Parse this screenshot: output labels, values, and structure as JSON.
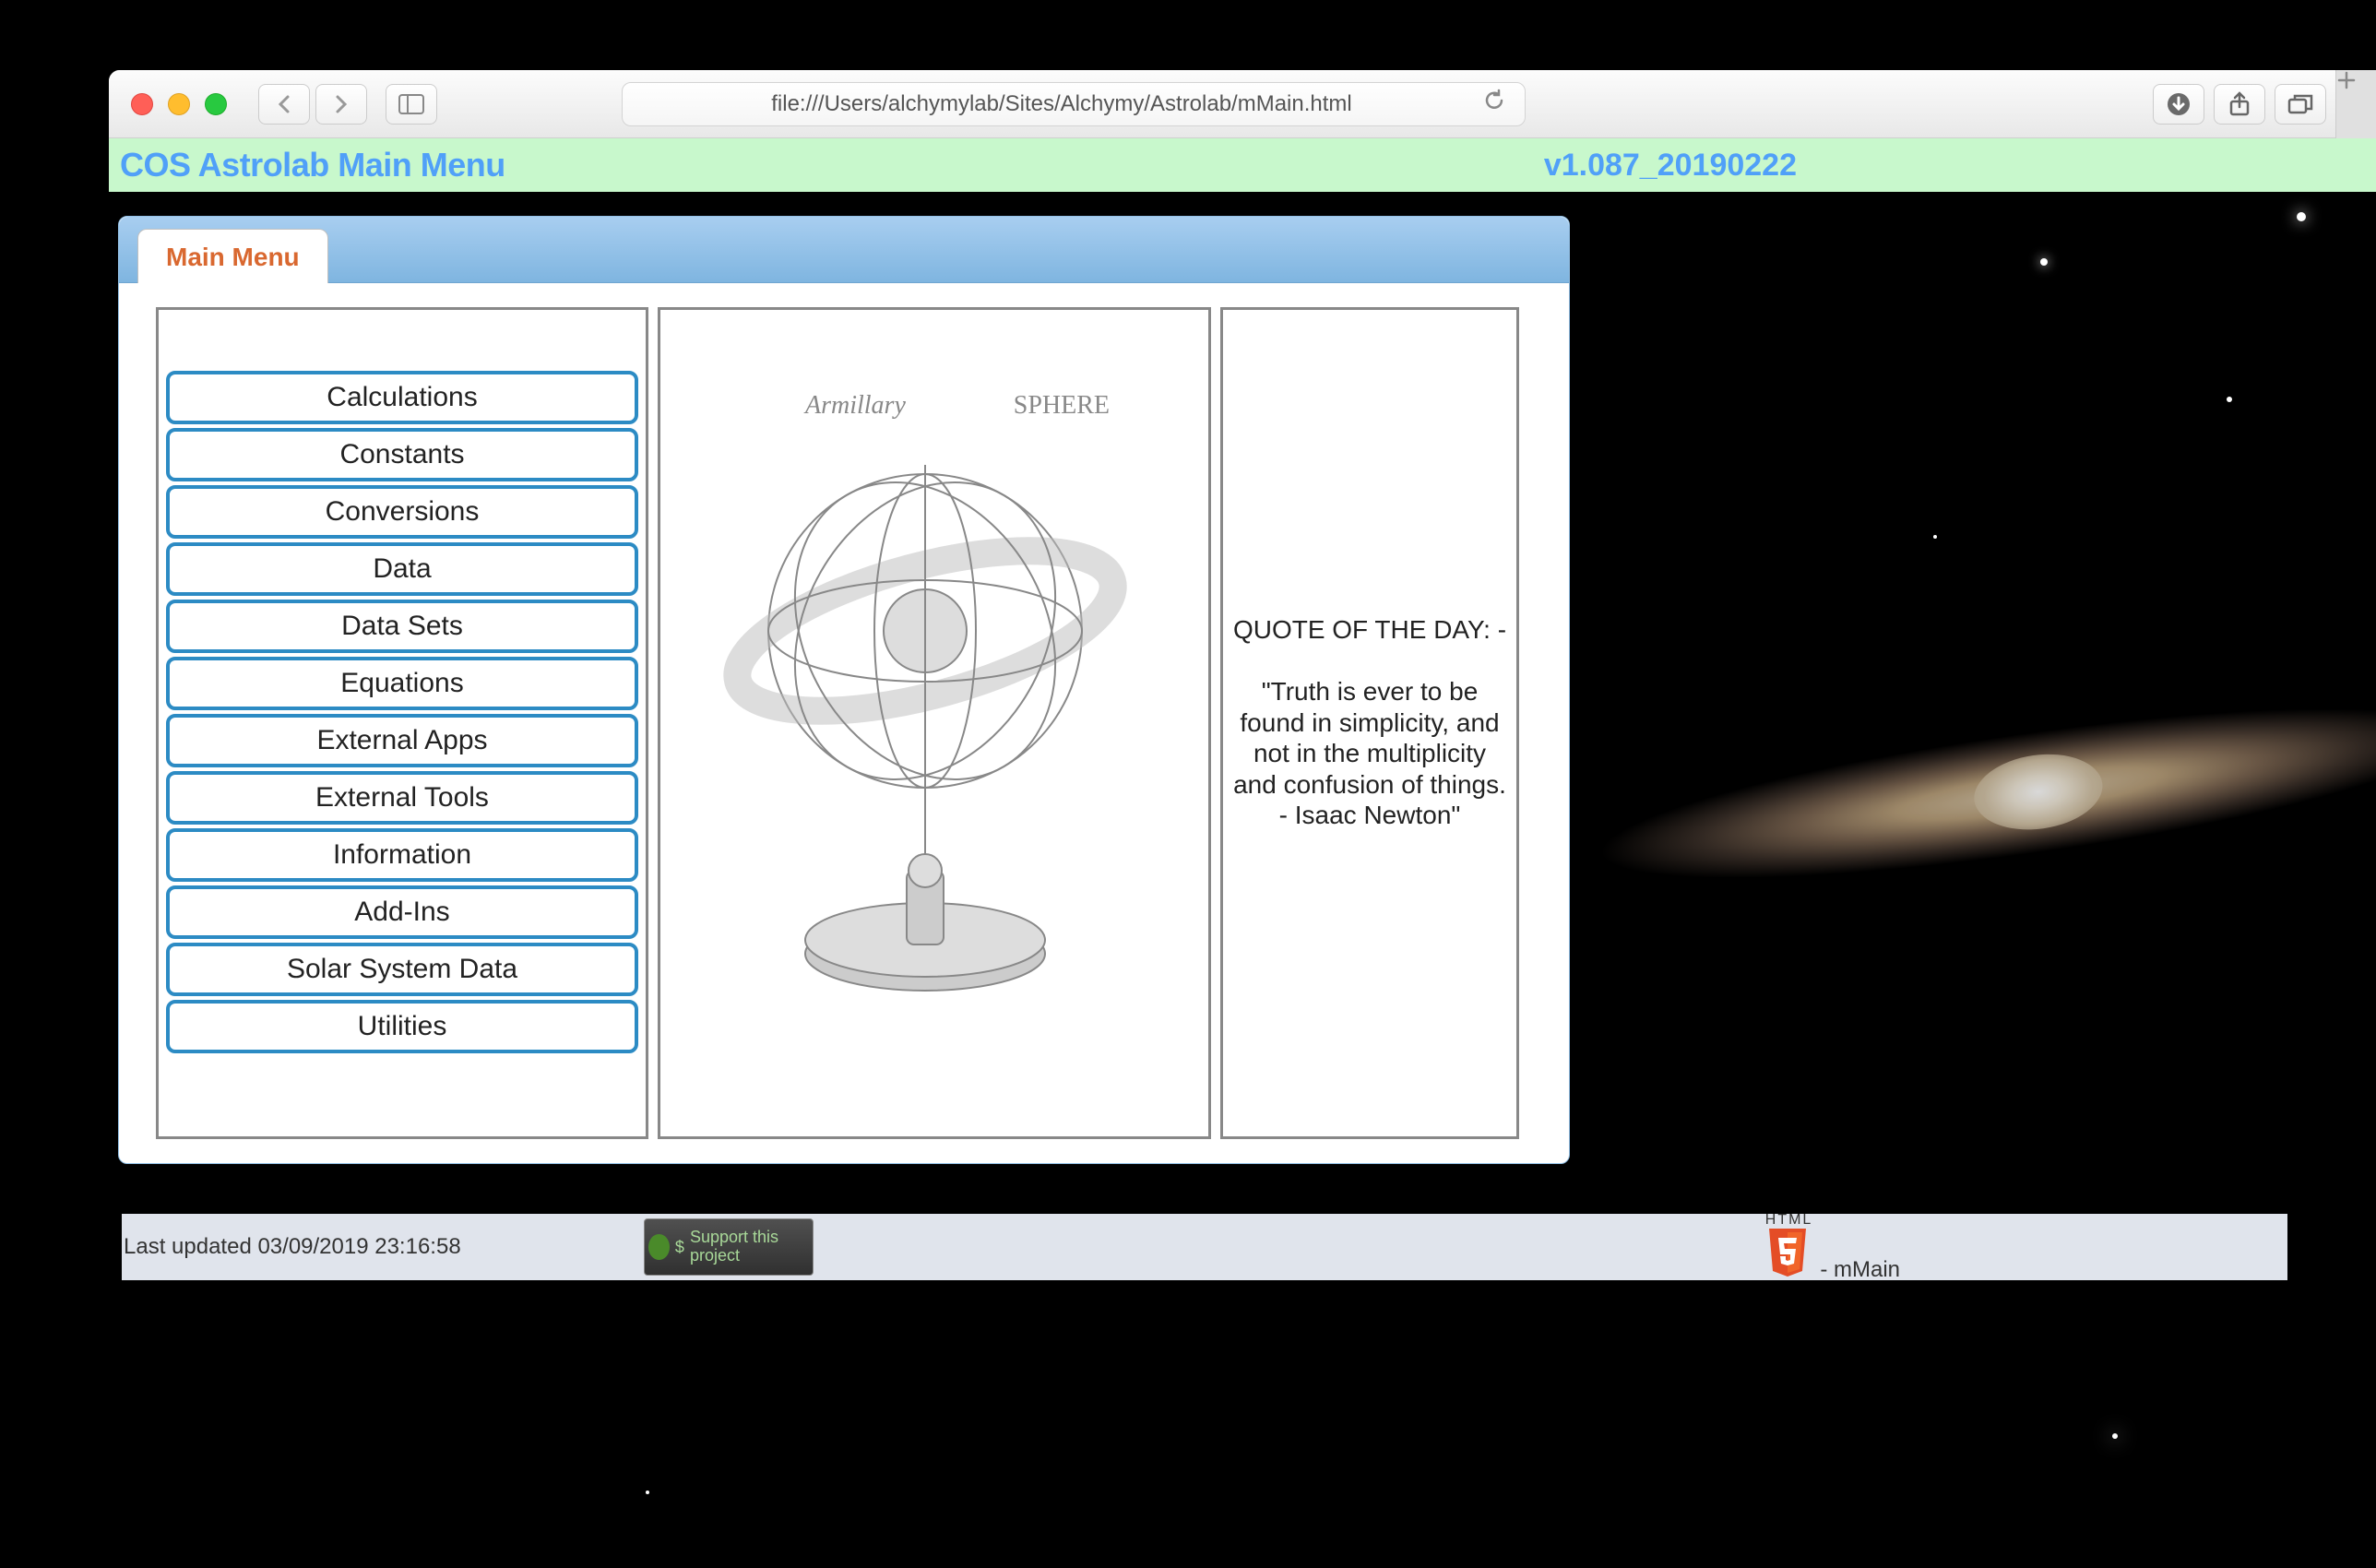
{
  "browser": {
    "url": "file:///Users/alchymylab/Sites/Alchymy/Astrolab/mMain.html"
  },
  "header": {
    "title": "COS Astrolab Main Menu",
    "version": "v1.087_20190222"
  },
  "tabs": {
    "active": "Main Menu"
  },
  "menu": {
    "items": [
      "Calculations",
      "Constants",
      "Conversions",
      "Data",
      "Data Sets",
      "Equations",
      "External Apps",
      "External Tools",
      "Information",
      "Add-Ins",
      "Solar System Data",
      "Utilities"
    ]
  },
  "illustration": {
    "label_left": "Armillary",
    "label_right": "SPHERE"
  },
  "quote": {
    "heading": "QUOTE OF THE DAY: -",
    "text": "\"Truth is ever to be found in simplicity, and not in the multiplicity and confusion of things. - Isaac Newton\""
  },
  "footer": {
    "updated": "Last updated 03/09/2019 23:16:58",
    "support_label": "Support this project",
    "html5_label": "HTML",
    "page_name": "- mMain"
  }
}
